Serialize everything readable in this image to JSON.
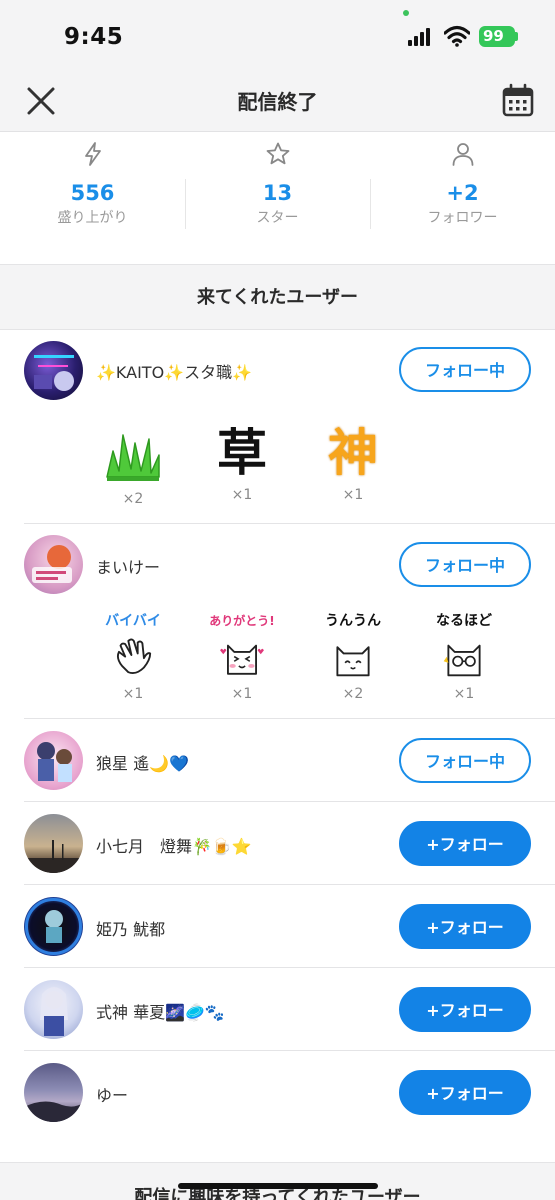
{
  "status_bar": {
    "time": "9:45",
    "battery": "99"
  },
  "header": {
    "title": "配信終了"
  },
  "stats": [
    {
      "icon": "lightning-icon",
      "value": "556",
      "label": "盛り上がり"
    },
    {
      "icon": "star-icon",
      "value": "13",
      "label": "スター"
    },
    {
      "icon": "person-icon",
      "value": "+2",
      "label": "フォロワー"
    }
  ],
  "section_title": "来てくれたユーザー",
  "users": [
    {
      "name": "✨KAITO✨スタ職✨",
      "button": "フォロー中",
      "following": true,
      "gifts": [
        {
          "icon": "grass-gift-icon",
          "count": "×2"
        },
        {
          "icon": "kusa-kanji-gift-icon",
          "text": "草",
          "count": "×1"
        },
        {
          "icon": "kami-kanji-gift-icon",
          "text": "神",
          "count": "×1"
        }
      ]
    },
    {
      "name": "まいけー",
      "button": "フォロー中",
      "following": true,
      "gifts": [
        {
          "icon": "byebye-hand-gift-icon",
          "text": "バイバイ",
          "count": "×1"
        },
        {
          "icon": "arigatou-cat-gift-icon",
          "text": "ありがとう!",
          "count": "×1"
        },
        {
          "icon": "unun-cat-gift-icon",
          "text": "うんうん",
          "count": "×2"
        },
        {
          "icon": "naruhodo-cat-gift-icon",
          "text": "なるほど",
          "count": "×1"
        }
      ]
    },
    {
      "name": "狼星 遙🌙💙",
      "button": "フォロー中",
      "following": true
    },
    {
      "name": "小七月　燈舞🎋🍺⭐",
      "button": "+フォロー",
      "following": false
    },
    {
      "name": "姫乃 魷都",
      "button": "+フォロー",
      "following": false
    },
    {
      "name": "式神 華夏🌌🥏🐾",
      "button": "+フォロー",
      "following": false
    },
    {
      "name": "ゆー",
      "button": "+フォロー",
      "following": false
    }
  ],
  "bottom_section_title": "配信に興味を持ってくれたユーザー",
  "colors": {
    "accent": "#1a8ee8",
    "follow_button": "#1383e6",
    "background": "#f4f4f5"
  }
}
